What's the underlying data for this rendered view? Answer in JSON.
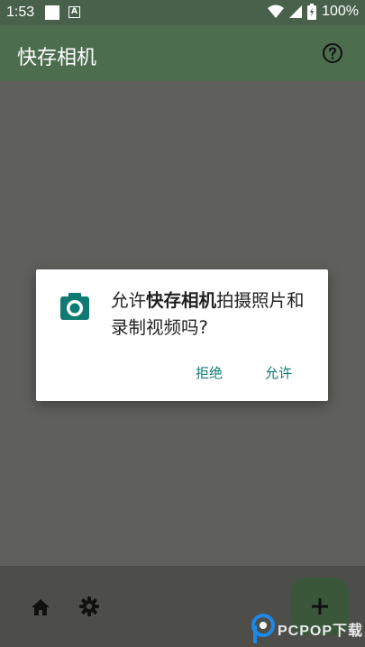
{
  "status_bar": {
    "time": "1:53",
    "battery_percent": "100%",
    "icons": [
      "notification-square-icon",
      "a-badge-icon",
      "wifi-icon",
      "signal-icon",
      "battery-icon"
    ]
  },
  "app_bar": {
    "title": "快存相机",
    "help_icon": "help-circle-icon"
  },
  "dialog": {
    "icon": "camera-icon",
    "message_prefix": "允许",
    "app_name": "快存相机",
    "message_suffix": "拍摄照片和录制视频吗?",
    "deny_label": "拒绝",
    "allow_label": "允许",
    "accent_color": "#0f7a71"
  },
  "bottom_bar": {
    "home_icon": "home-icon",
    "settings_icon": "gear-icon",
    "fab_icon": "plus-icon"
  },
  "watermark": {
    "text": "PCPOP下载"
  }
}
